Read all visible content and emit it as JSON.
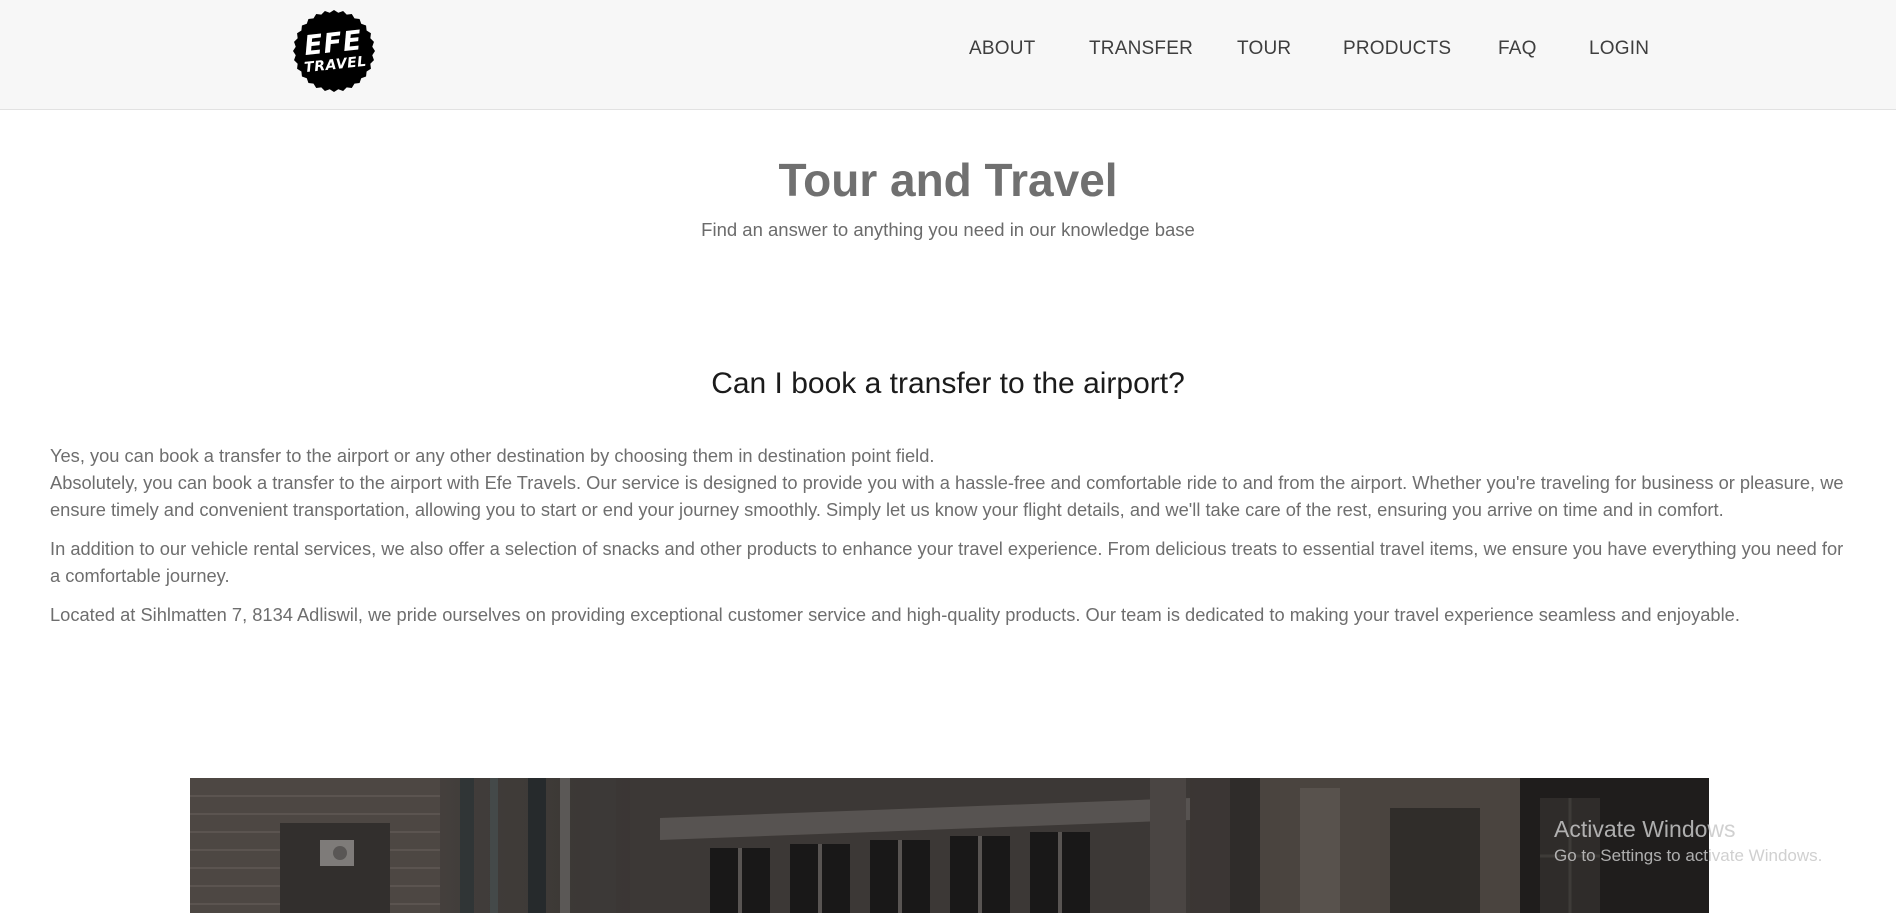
{
  "header": {
    "logo": {
      "line1": "EFE",
      "line2": "TRAVEL"
    },
    "nav": [
      {
        "label": "ABOUT"
      },
      {
        "label": "TRANSFER"
      },
      {
        "label": "TOUR"
      },
      {
        "label": "PRODUCTS"
      },
      {
        "label": "FAQ"
      },
      {
        "label": "LOGIN"
      }
    ]
  },
  "hero": {
    "title": "Tour and Travel",
    "subtitle": "Find an answer to anything you need in our knowledge base"
  },
  "faq": {
    "question": "Can I book a transfer to the airport?",
    "paragraphs": [
      "Yes, you can book a transfer to the airport or any other destination by choosing them in destination point field.",
      "Absolutely, you can book a transfer to the airport with Efe Travels. Our service is designed to provide you with a hassle-free and comfortable ride to and from the airport. Whether you're traveling for business or pleasure, we ensure timely and convenient transportation, allowing you to start or end your journey smoothly. Simply let us know your flight details, and we'll take care of the rest, ensuring you arrive on time and in comfort.",
      "In addition to our vehicle rental services, we also offer a selection of snacks and other products to enhance your travel experience. From delicious treats to essential travel items, we ensure you have everything you need for a comfortable journey.",
      "Located at Sihlmatten 7, 8134 Adliswil, we pride ourselves on providing exceptional customer service and high-quality products. Our team is dedicated to making your travel experience seamless and enjoyable."
    ]
  },
  "watermark": {
    "title": "Activate Windows",
    "subtitle": "Go to Settings to activate Windows."
  },
  "colors": {
    "navbar_bg": "#f7f7f7",
    "logo_bg": "#000000",
    "title_text": "#707070",
    "question_text": "#1b1b1b",
    "body_text": "#6e6e6e"
  }
}
